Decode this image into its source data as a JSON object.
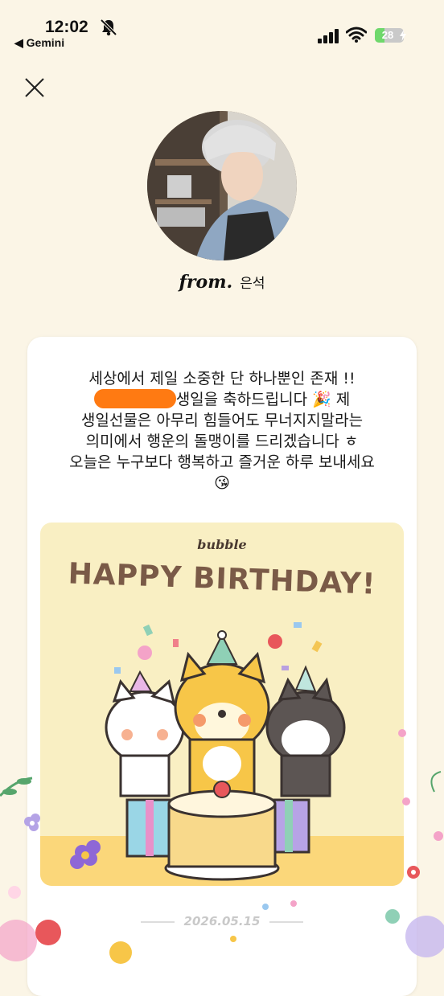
{
  "status_bar": {
    "time": "12:02",
    "back_app": "◀ Gemini",
    "battery": "28"
  },
  "header": {
    "from_prefix": "from.",
    "sender_name": "은석"
  },
  "message": {
    "line1": "세상에서 제일 소중한 단 하나뿐인 존재 !!",
    "line2": "생일을 축하드립니다 🎉  제",
    "line3": "생일선물은 아무리 힘들어도 무너지지말라는",
    "line4": "의미에서 행운의 돌맹이를 드리겠습니다 ㅎ",
    "line5": "오늘은 누구보다 행복하고 즐거운 하루 보내세요",
    "line6": "😘"
  },
  "birthday_card": {
    "brand": "bubble",
    "headline": "HAPPY BIRTHDAY!"
  },
  "footer": {
    "date": "2026.05.15"
  },
  "icons": {
    "close": "close-icon",
    "bell_muted": "bell-slash-icon",
    "signal": "cellular-signal-icon",
    "wifi": "wifi-icon",
    "battery": "battery-charging-icon"
  },
  "colors": {
    "background": "#fbf5e6",
    "card": "#ffffff",
    "birthday_card_bg": "#f9efc3",
    "redaction": "#ff7a12",
    "headline": "#7a5a47"
  }
}
